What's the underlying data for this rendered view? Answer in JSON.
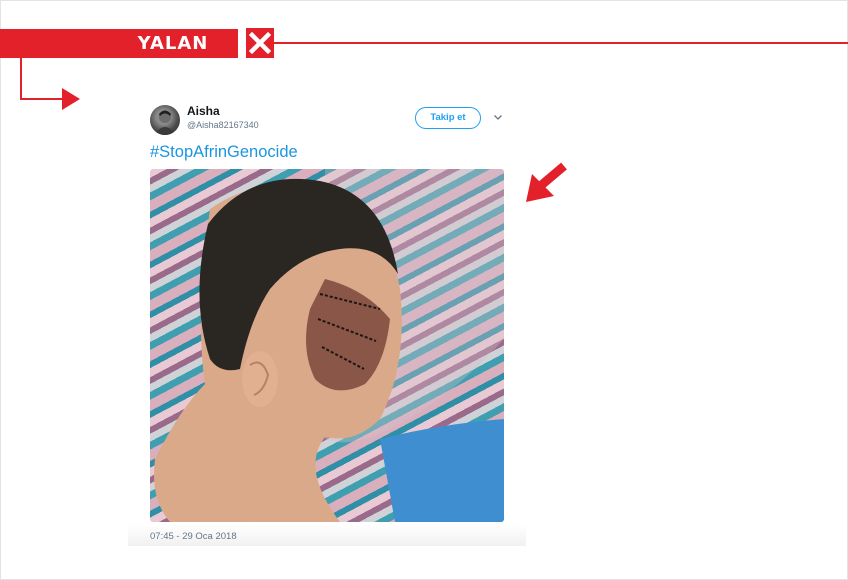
{
  "verdict": {
    "label": "YALAN",
    "icon": "close-icon",
    "color": "#e3212b"
  },
  "tweet": {
    "display_name": "Aisha",
    "handle": "@Aisha82167340",
    "follow_label": "Takip et",
    "menu_icon": "chevron-down-icon",
    "hashtag": "#StopAfrinGenocide",
    "timestamp": "07:45 - 29 Oca 2018",
    "link_color": "#1b95e0"
  },
  "annotation": {
    "pointer_icon": "arrow-pointer-icon"
  }
}
